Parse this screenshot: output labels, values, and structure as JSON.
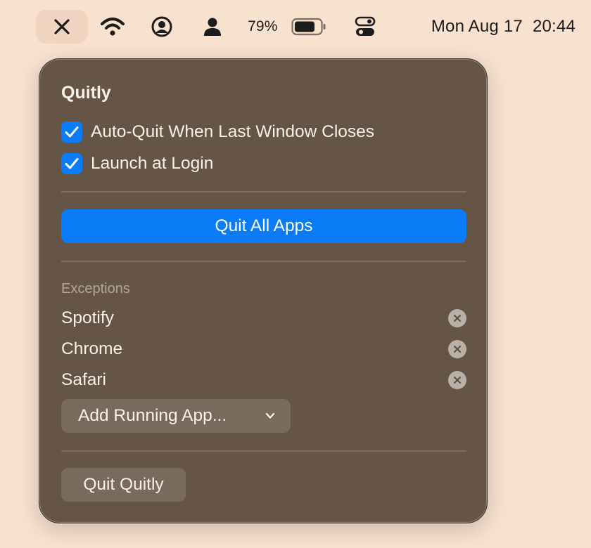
{
  "menubar": {
    "icons": [
      "close-icon",
      "wifi-icon",
      "user-circle-icon",
      "person-icon",
      "battery-icon",
      "control-center-icon"
    ],
    "battery_percent": "79%",
    "battery_level": 0.79,
    "date": "Mon Aug 17",
    "time": "20:44"
  },
  "panel": {
    "title": "Quitly",
    "options": [
      {
        "label": "Auto-Quit When Last Window Closes",
        "checked": true
      },
      {
        "label": "Launch at Login",
        "checked": true
      }
    ],
    "primary_button": "Quit All Apps",
    "exceptions_label": "Exceptions",
    "exceptions": [
      "Spotify",
      "Chrome",
      "Safari"
    ],
    "add_dropdown": "Add Running App...",
    "quit_button": "Quit Quitly"
  },
  "colors": {
    "accent": "#0a7cf8",
    "panel_bg": "#645547",
    "desktop_bg": "#f7e1cf"
  }
}
